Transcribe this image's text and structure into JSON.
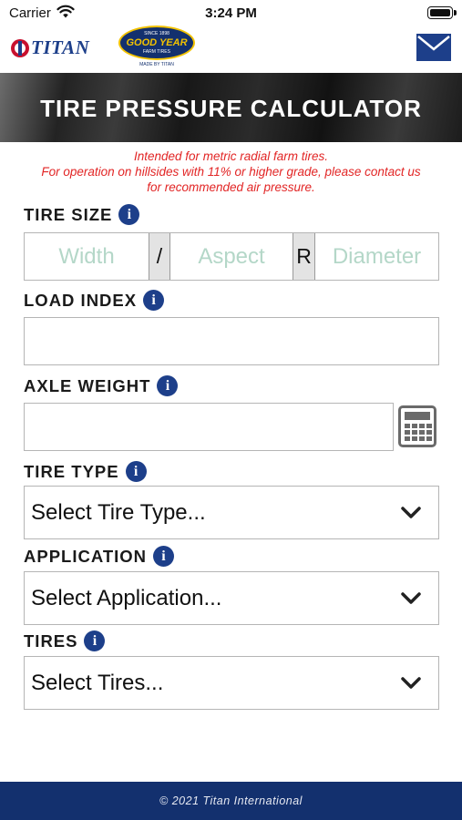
{
  "status_bar": {
    "carrier": "Carrier",
    "time": "3:24 PM"
  },
  "header": {
    "titan_brand": "TITAN",
    "goodyear_since": "SINCE 1898",
    "goodyear_brand": "GOOD YEAR",
    "goodyear_sub": "FARM TIRES",
    "goodyear_made_by": "MADE BY TITAN",
    "mail_icon": "envelope-icon"
  },
  "banner": {
    "title": "TIRE PRESSURE CALCULATOR"
  },
  "notice": {
    "line1": "Intended for metric radial farm tires.",
    "line2": "For operation on hillsides with 11% or higher grade, please contact us",
    "line3": "for recommended air pressure."
  },
  "form": {
    "tire_size": {
      "label": "TIRE SIZE",
      "width_placeholder": "Width",
      "separator": "/",
      "aspect_placeholder": "Aspect",
      "radial_marker": "R",
      "diameter_placeholder": "Diameter"
    },
    "load_index": {
      "label": "LOAD INDEX",
      "value": ""
    },
    "axle_weight": {
      "label": "AXLE WEIGHT",
      "value": "",
      "calculator_icon": "calculator-icon"
    },
    "tire_type": {
      "label": "TIRE TYPE",
      "selected": "Select Tire Type..."
    },
    "application": {
      "label": "APPLICATION",
      "selected": "Select Application..."
    },
    "tires": {
      "label": "TIRES",
      "selected": "Select Tires..."
    },
    "info_glyph": "i"
  },
  "footer": {
    "copyright": "© 2021 Titan International"
  },
  "colors": {
    "brand_navy": "#1d3f8a",
    "footer_navy": "#13306e",
    "notice_red": "#e22525",
    "placeholder_green": "#b4d7c8"
  }
}
